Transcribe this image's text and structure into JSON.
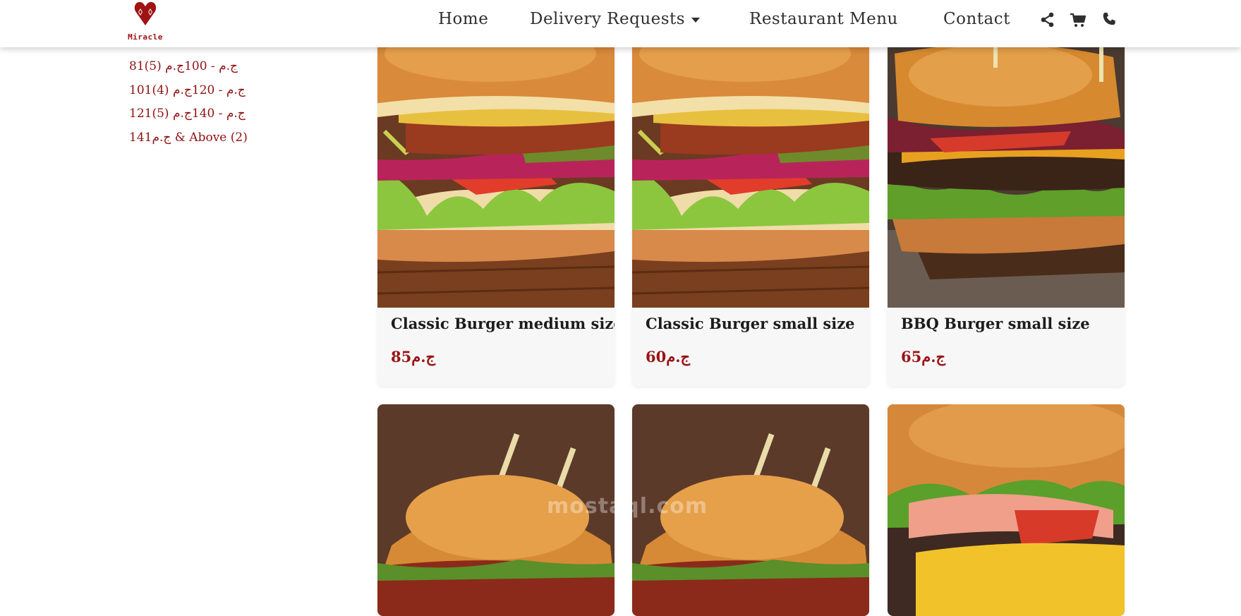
{
  "brand": {
    "name": "Miracle",
    "color": "#a01214"
  },
  "nav": {
    "home": "Home",
    "delivery": "Delivery Requests",
    "menu": "Restaurant Menu",
    "contact": "Contact",
    "icons": [
      "share-icon",
      "cart-icon",
      "phone-icon"
    ]
  },
  "filters": [
    "81ج.م - 100ج.م  (5)",
    "101ج.م - 120ج.م  (4)",
    "121ج.م - 140ج.م  (5)",
    "141ج.م & Above (2)"
  ],
  "products": [
    {
      "title": "Classic Burger medium size",
      "price": "85ج.م"
    },
    {
      "title": "Classic Burger small size",
      "price": "60ج.م"
    },
    {
      "title": "BBQ Burger small size",
      "price": "65ج.م"
    }
  ],
  "watermark": "mostaql.com",
  "colors": {
    "accent": "#9a1414",
    "text": "#2f2f2f",
    "card_bg": "#f7f7f7"
  }
}
